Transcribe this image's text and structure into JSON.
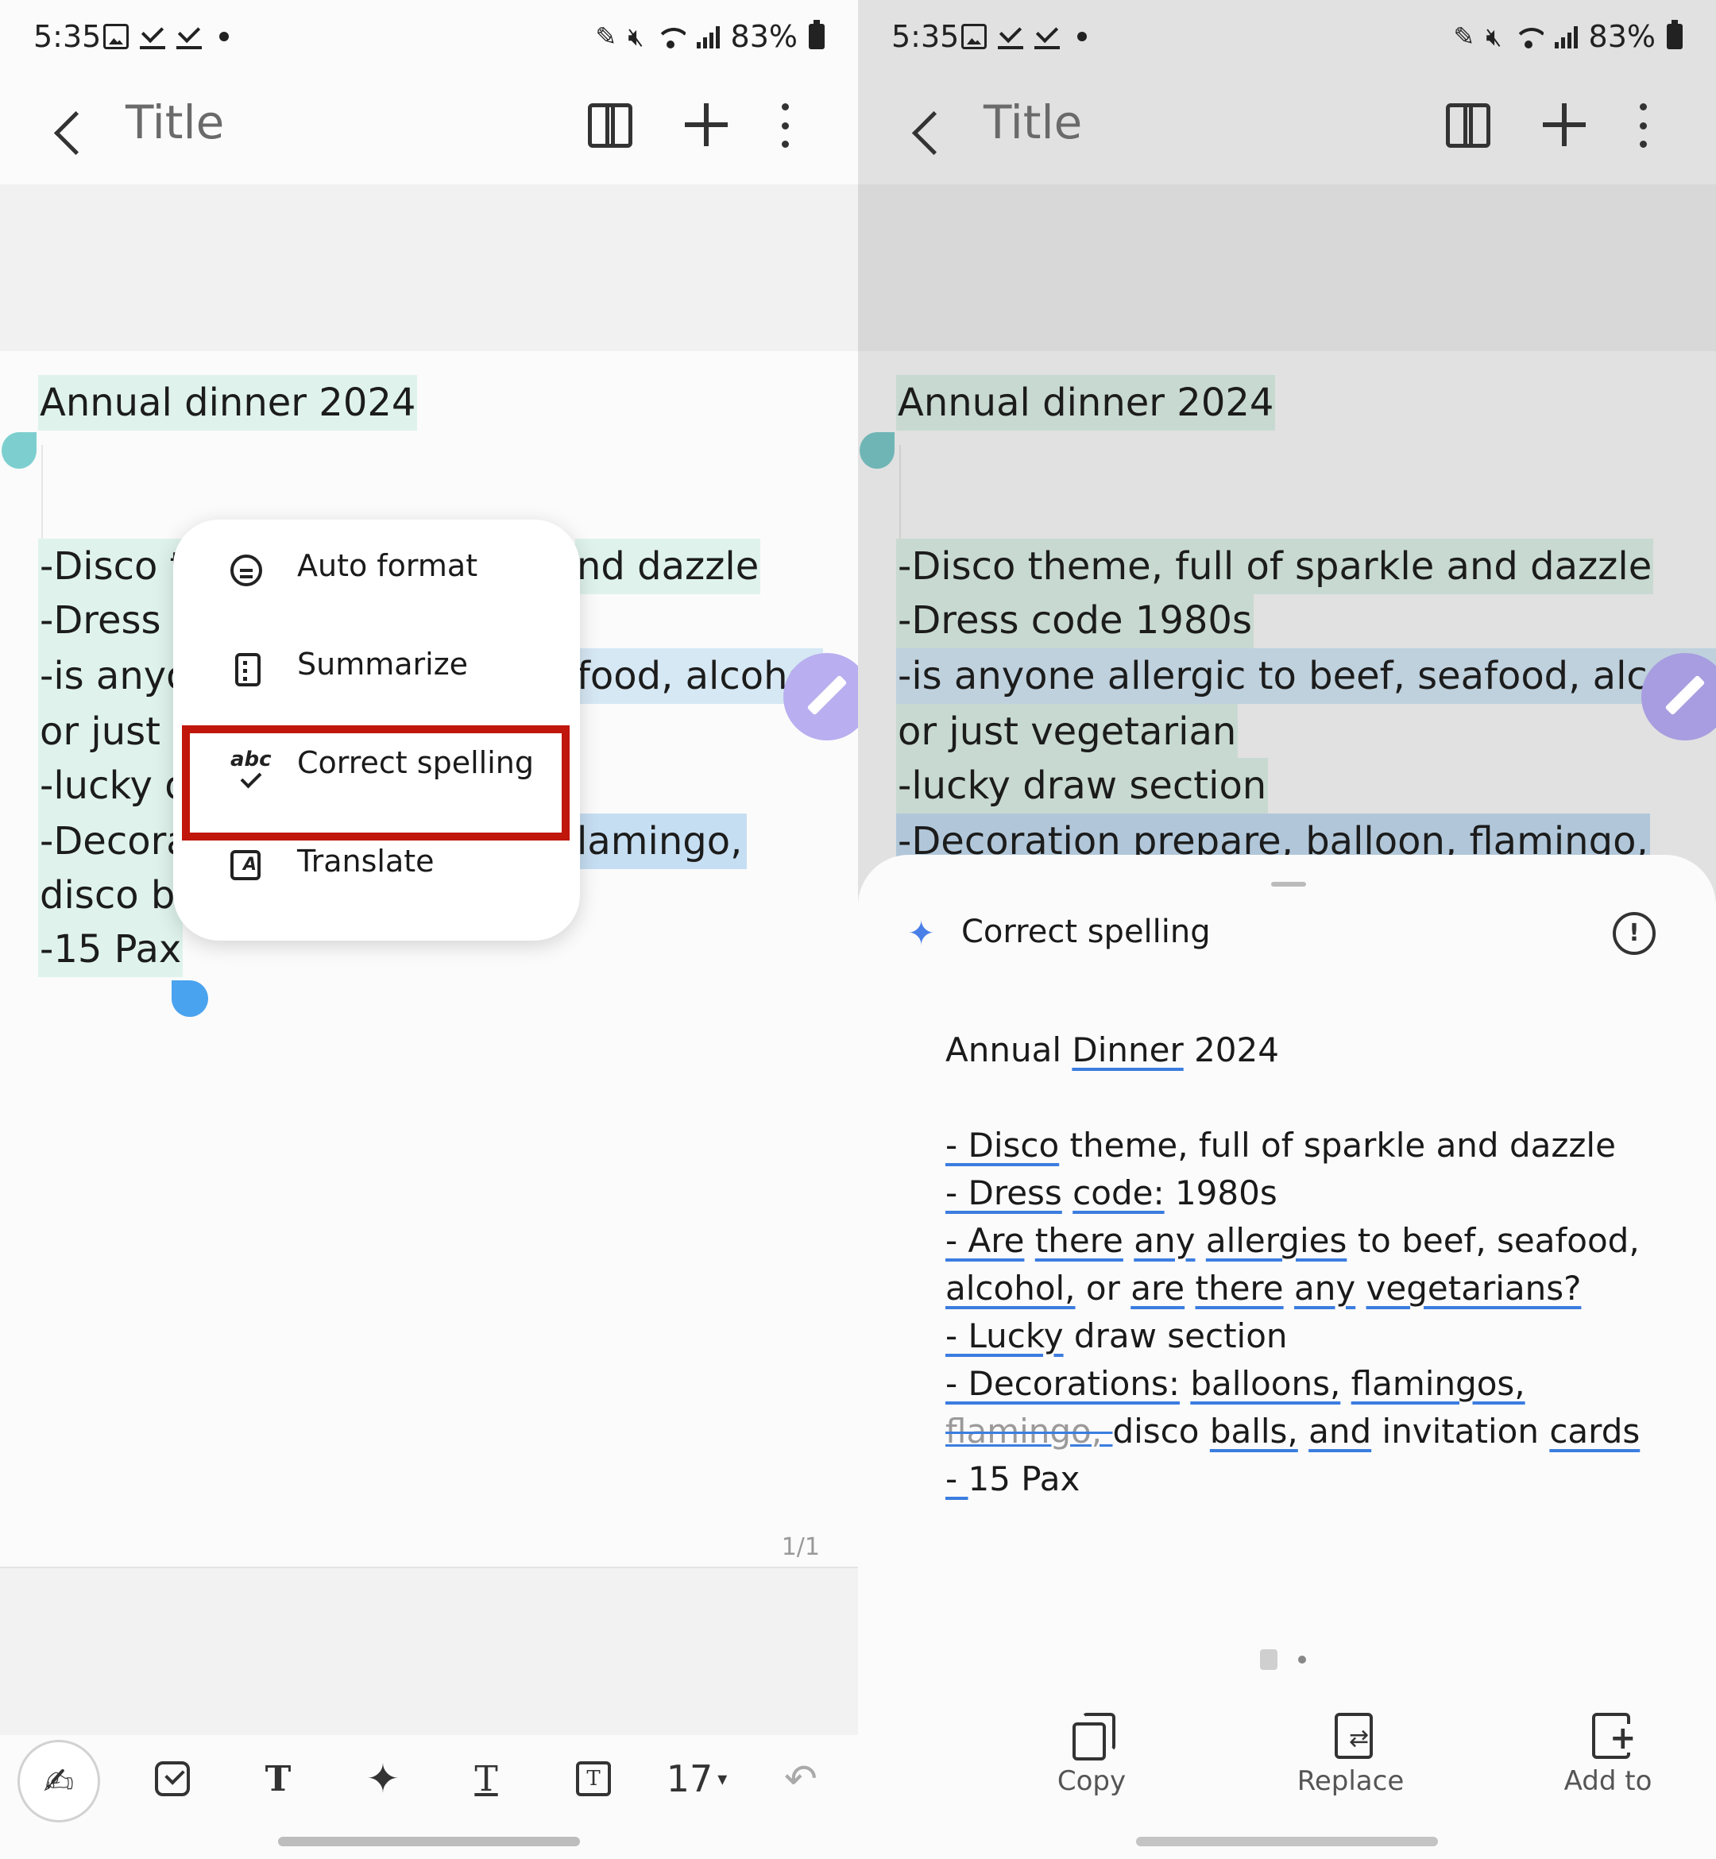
{
  "status": {
    "time": "5:35",
    "battery": "83%"
  },
  "left": {
    "appbar": {
      "title": "Title"
    },
    "note_lines": [
      "Annual dinner 2024",
      "-Disco t",
      "nd dazzle",
      "-Dress c",
      "-is anyo",
      "food, alcohol",
      "or just v",
      "-lucky d",
      "-Decora",
      "lamingo,",
      "disco ba",
      "-15 Pax"
    ],
    "menu": {
      "items": [
        {
          "label": "Auto format",
          "icon": "auto-format-icon"
        },
        {
          "label": "Summarize",
          "icon": "summarize-icon"
        },
        {
          "label": "Correct spelling",
          "icon": "spellcheck-icon"
        },
        {
          "label": "Translate",
          "icon": "translate-icon"
        }
      ],
      "highlighted": "Correct spelling"
    },
    "page_indicator": "1/1",
    "toolbar": {
      "font_size": "17",
      "size_arrow": "▾",
      "text_style_glyph": "T",
      "box_glyph": "T",
      "underline_glyph": "T",
      "pen_glyph": "✍",
      "ai_glyph": "✦",
      "undo_glyph": "↶"
    }
  },
  "right": {
    "appbar": {
      "title": "Title"
    },
    "note_lines": [
      "Annual dinner 2024",
      "-Disco theme, full of sparkle and dazzle",
      "-Dress code 1980s",
      "-is anyone allergic to beef, seafood, alcohol",
      "or just vegetarian",
      "-lucky draw section",
      "-Decoration prepare, balloon, flamingo,"
    ],
    "sheet": {
      "title": "Correct spelling",
      "info_glyph": "!",
      "sparkle_glyph": "✦",
      "result": {
        "l1a": "Annual ",
        "l1b": "Dinner",
        "l1c": " 2024",
        "l2a": "- Disco",
        "l2b": " theme, full of sparkle and dazzle",
        "l3a": "- Dress",
        "l3b": " ",
        "l3c": "code:",
        "l3d": " 1980s",
        "l4a": "- Are",
        "l4b": " ",
        "l4c": "there",
        "l4d": " ",
        "l4e": "any",
        "l4f": " ",
        "l4g": "allergies",
        "l4h": " to beef, seafood,",
        "l5a": "alcohol,",
        "l5b": " or ",
        "l5c": "are",
        "l5d": " ",
        "l5e": "there",
        "l5f": " ",
        "l5g": "any",
        "l5h": " ",
        "l5i": "vegetarians?",
        "l6a": "- Lucky",
        "l6b": " draw section",
        "l7a": "- Decorations:",
        "l7b": " ",
        "l7c": "balloons,",
        "l7d": " ",
        "l7e": "flamingos,",
        "l8a": "flamingo, ",
        "l8b": "disco ",
        "l8c": "balls,",
        "l8d": " ",
        "l8e": "and",
        "l8f": " invitation ",
        "l8g": "cards",
        "l9a": "- ",
        "l9b": "15 Pax"
      },
      "actions": [
        {
          "label": "Copy",
          "icon": "copy-icon"
        },
        {
          "label": "Replace",
          "icon": "replace-icon"
        },
        {
          "label": "Add to",
          "icon": "add-to-icon"
        }
      ]
    }
  },
  "colors": {
    "accent_blue": "#3b7de0",
    "highlight_red": "#c0160c",
    "selection_green": "#dff3ec",
    "fab_purple": "#b9aef0"
  }
}
